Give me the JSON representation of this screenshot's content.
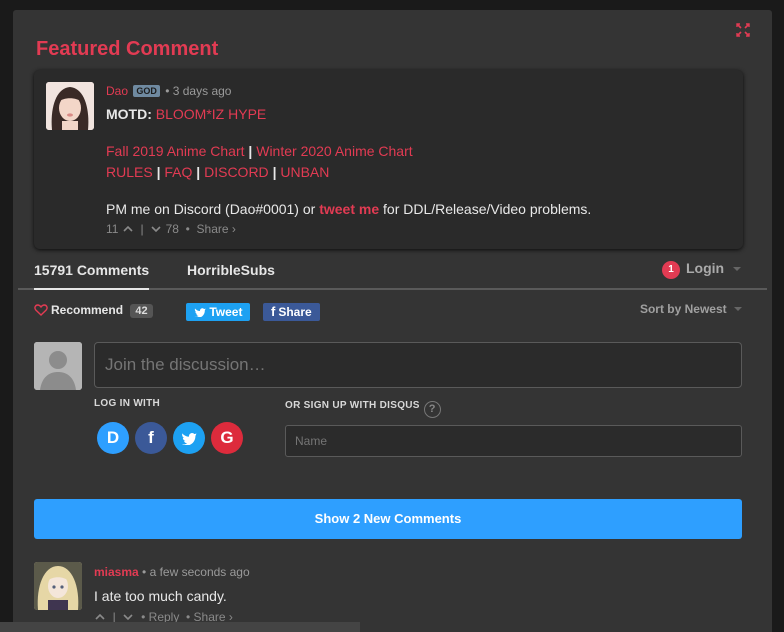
{
  "featured": {
    "title": "Featured Comment",
    "author": "Dao",
    "badge": "GOD",
    "meta": "• 3 days ago",
    "motd_label": "MOTD:",
    "motd_text": "BLOOM*IZ HYPE",
    "link_fall": "Fall 2019 Anime Chart",
    "link_winter": "Winter 2020 Anime Chart",
    "link_rules": "RULES",
    "link_faq": "FAQ",
    "link_discord": "DISCORD",
    "link_unban": "UNBAN",
    "separator": "|",
    "pm_text_before": "PM me on Discord (Dao#0001) or",
    "pm_link": "tweet me",
    "pm_text_after": "for DDL/Release/Video problems.",
    "upvotes": "11",
    "downvotes": "78",
    "share": "Share ›"
  },
  "tabs": {
    "comments": "15791 Comments",
    "site": "HorribleSubs",
    "notif_count": "1",
    "login": "Login"
  },
  "toolbar": {
    "recommend": "Recommend",
    "recommend_count": "42",
    "tweet": "Tweet",
    "share": "Share",
    "sort": "Sort by Newest"
  },
  "compose": {
    "placeholder": "Join the discussion…",
    "login_with": "LOG IN WITH",
    "signup_with": "OR SIGN UP WITH DISQUS",
    "name_placeholder": "Name",
    "disqus_glyph": "D",
    "facebook_glyph": "f",
    "google_glyph": "G"
  },
  "new_comments_button": "Show 2 New Comments",
  "comment": {
    "author": "miasma",
    "meta": "• a few seconds ago",
    "text": "I ate too much candy.",
    "reply": "• Reply",
    "share": "• Share ›"
  },
  "colors": {
    "accent": "#e23b53",
    "background": "#343434",
    "button_blue": "#2e9fff",
    "twitter": "#1da1f2",
    "facebook": "#3b5998",
    "google": "#dd4b39"
  },
  "icons": [
    "close-icon",
    "heart-icon",
    "twitter-icon",
    "facebook-icon",
    "google-icon",
    "disqus-icon",
    "chevron-up-icon",
    "chevron-down-icon",
    "help-icon"
  ]
}
